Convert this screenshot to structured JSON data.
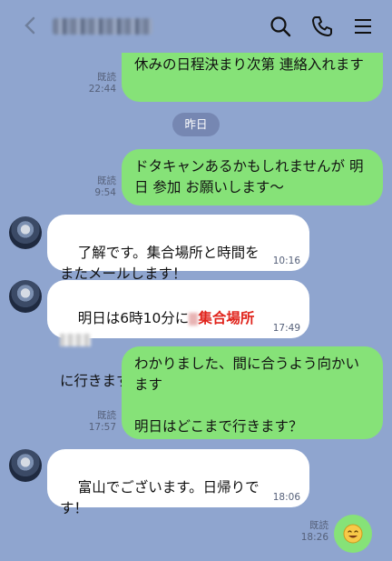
{
  "header": {
    "contact_name": "",
    "icons": [
      "back-chevron-icon",
      "search-icon",
      "phone-icon",
      "menu-icon"
    ]
  },
  "date_separator": "昨日",
  "messages": [
    {
      "side": "mine",
      "text": "休みの日程決まり次第 連絡入れます",
      "read": "既読",
      "time": "22:44"
    },
    {
      "side": "mine",
      "text": "ドタキャンあるかもしれませんが 明日 参加 お願いします〜",
      "read": "既読",
      "time": "9:54"
    },
    {
      "side": "theirs",
      "text": "了解です。集合場所と時間をまたメールします！",
      "time": "10:16"
    },
    {
      "side": "theirs",
      "text_before": "明日は6時10分に",
      "text_highlight": "集合場所",
      "text_after": "に行きます！",
      "time": "17:49"
    },
    {
      "side": "mine",
      "text": "わかりました、間に合うよう向かいます\n\n明日はどこまで行きます？",
      "read": "既読",
      "time": "17:57"
    },
    {
      "side": "theirs",
      "text": "富山でございます。日帰りです！",
      "time": "18:06"
    },
    {
      "side": "mine",
      "emoji": "smiling-face",
      "read": "既読",
      "time": "18:26"
    }
  ],
  "colors": {
    "background": "#8fa5cf",
    "mine_bubble": "#86e278",
    "theirs_bubble": "#ffffff",
    "date_pill": "#7687b2"
  }
}
